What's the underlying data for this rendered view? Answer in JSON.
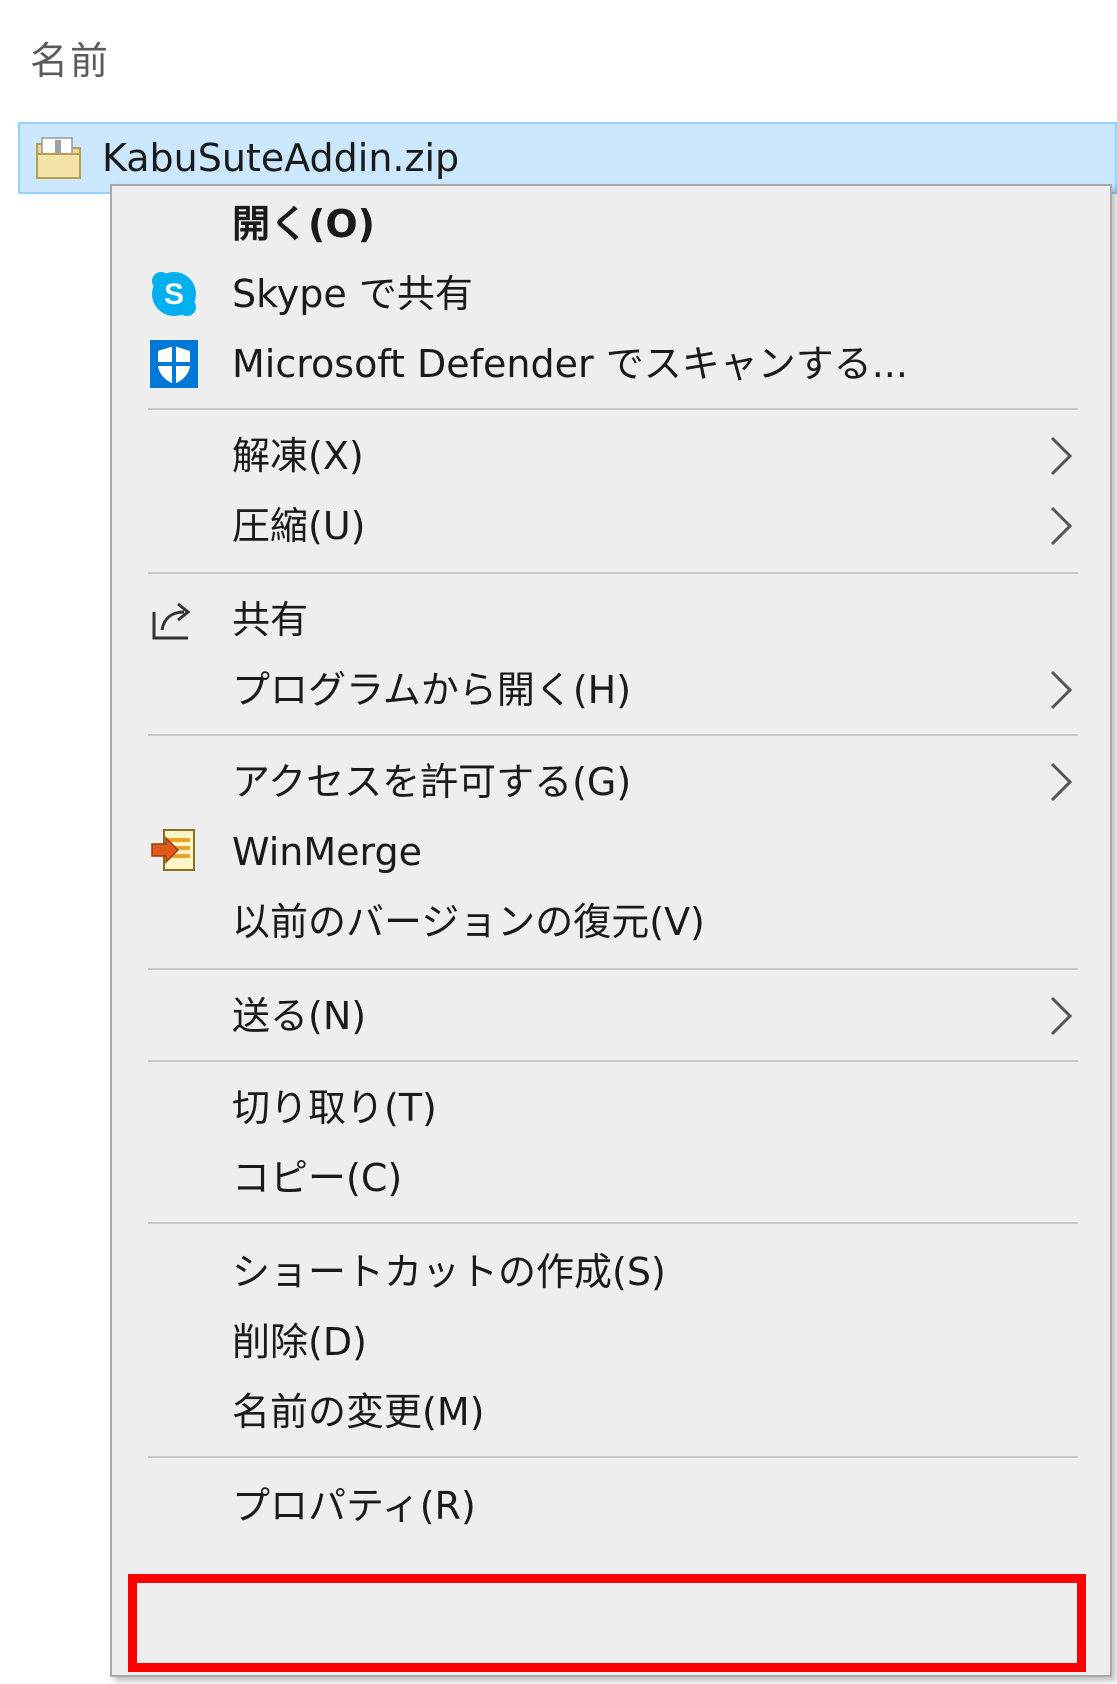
{
  "column_header": "名前",
  "file": {
    "name": "KabuSuteAddin.zip",
    "icon": "zip-folder-icon"
  },
  "menu": {
    "items": [
      {
        "label": "開く(O)",
        "icon": null,
        "submenu": false,
        "bold": true
      },
      {
        "label": "Skype で共有",
        "icon": "skype-icon",
        "submenu": false
      },
      {
        "label": "Microsoft Defender でスキャンする...",
        "icon": "defender-shield-icon",
        "submenu": false
      },
      {
        "label": "解凍(X)",
        "icon": null,
        "submenu": true
      },
      {
        "label": "圧縮(U)",
        "icon": null,
        "submenu": true
      },
      {
        "label": "共有",
        "icon": "share-icon",
        "submenu": false
      },
      {
        "label": "プログラムから開く(H)",
        "icon": null,
        "submenu": true
      },
      {
        "label": "アクセスを許可する(G)",
        "icon": null,
        "submenu": true
      },
      {
        "label": "WinMerge",
        "icon": "winmerge-icon",
        "submenu": false
      },
      {
        "label": "以前のバージョンの復元(V)",
        "icon": null,
        "submenu": false
      },
      {
        "label": "送る(N)",
        "icon": null,
        "submenu": true
      },
      {
        "label": "切り取り(T)",
        "icon": null,
        "submenu": false
      },
      {
        "label": "コピー(C)",
        "icon": null,
        "submenu": false
      },
      {
        "label": "ショートカットの作成(S)",
        "icon": null,
        "submenu": false
      },
      {
        "label": "削除(D)",
        "icon": null,
        "submenu": false
      },
      {
        "label": "名前の変更(M)",
        "icon": null,
        "submenu": false
      },
      {
        "label": "プロパティ(R)",
        "icon": null,
        "submenu": false,
        "highlighted": true
      }
    ]
  },
  "colors": {
    "selection_bg": "#cce8ff",
    "selection_border": "#99d1ff",
    "menu_bg": "#eeeeee",
    "separator": "#c8c8c8",
    "highlight": "#ff0000",
    "skype_blue": "#00aff0",
    "defender_blue": "#0078d7"
  }
}
